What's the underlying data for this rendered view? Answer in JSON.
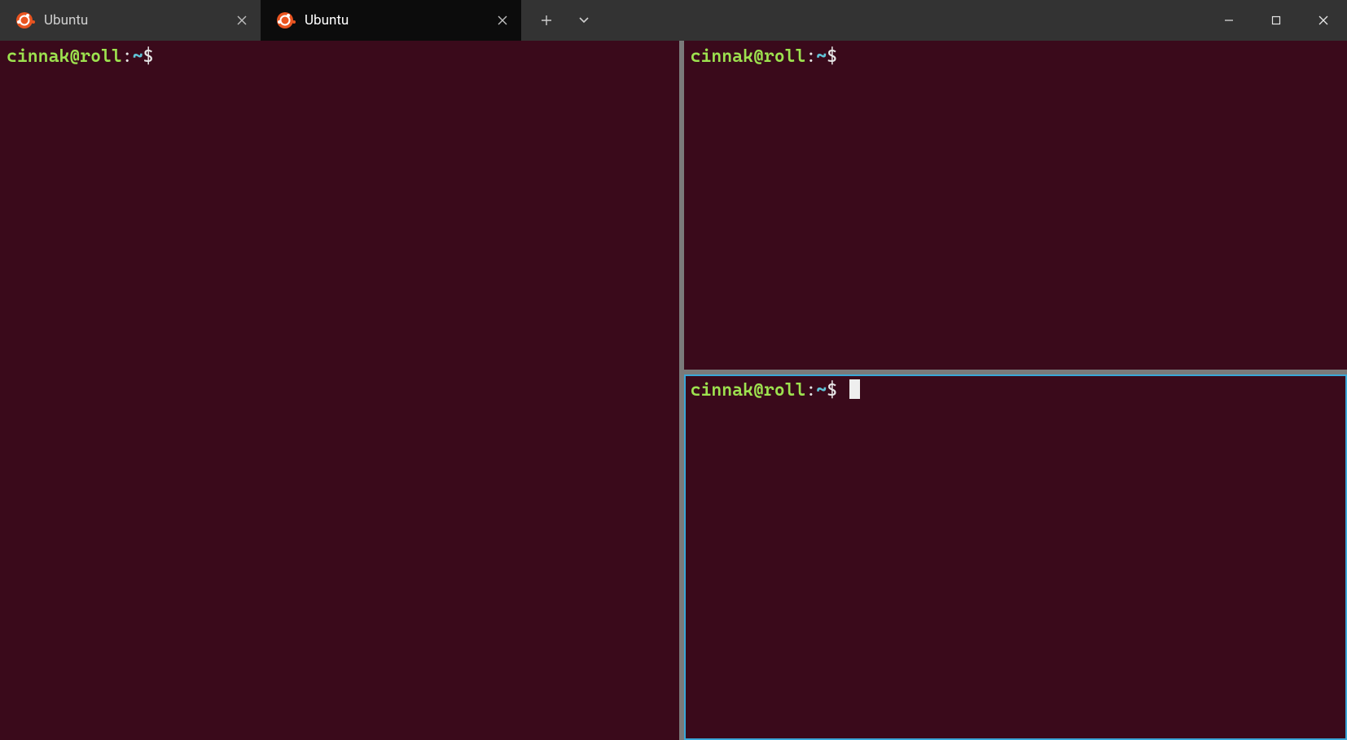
{
  "tabs": [
    {
      "label": "Ubuntu",
      "active": false,
      "icon": "ubuntu"
    },
    {
      "label": "Ubuntu",
      "active": true,
      "icon": "ubuntu"
    }
  ],
  "prompt": {
    "user_host": "cinnak@roll",
    "colon": ":",
    "path": "~",
    "dollar": "$",
    "space": " "
  },
  "panes": {
    "left": {
      "focused": false,
      "has_cursor": false
    },
    "right_top": {
      "focused": false,
      "has_cursor": false
    },
    "right_bottom": {
      "focused": true,
      "has_cursor": true
    }
  },
  "colors": {
    "titlebar_bg": "#333333",
    "active_tab_bg": "#0c0c0c",
    "terminal_bg": "#3a0a1b",
    "splitter": "#7a7a7a",
    "focus_border": "#3aa7d8",
    "prompt_userhost": "#9de24f",
    "prompt_path": "#60c5d8",
    "ubuntu_orange": "#e95420"
  }
}
